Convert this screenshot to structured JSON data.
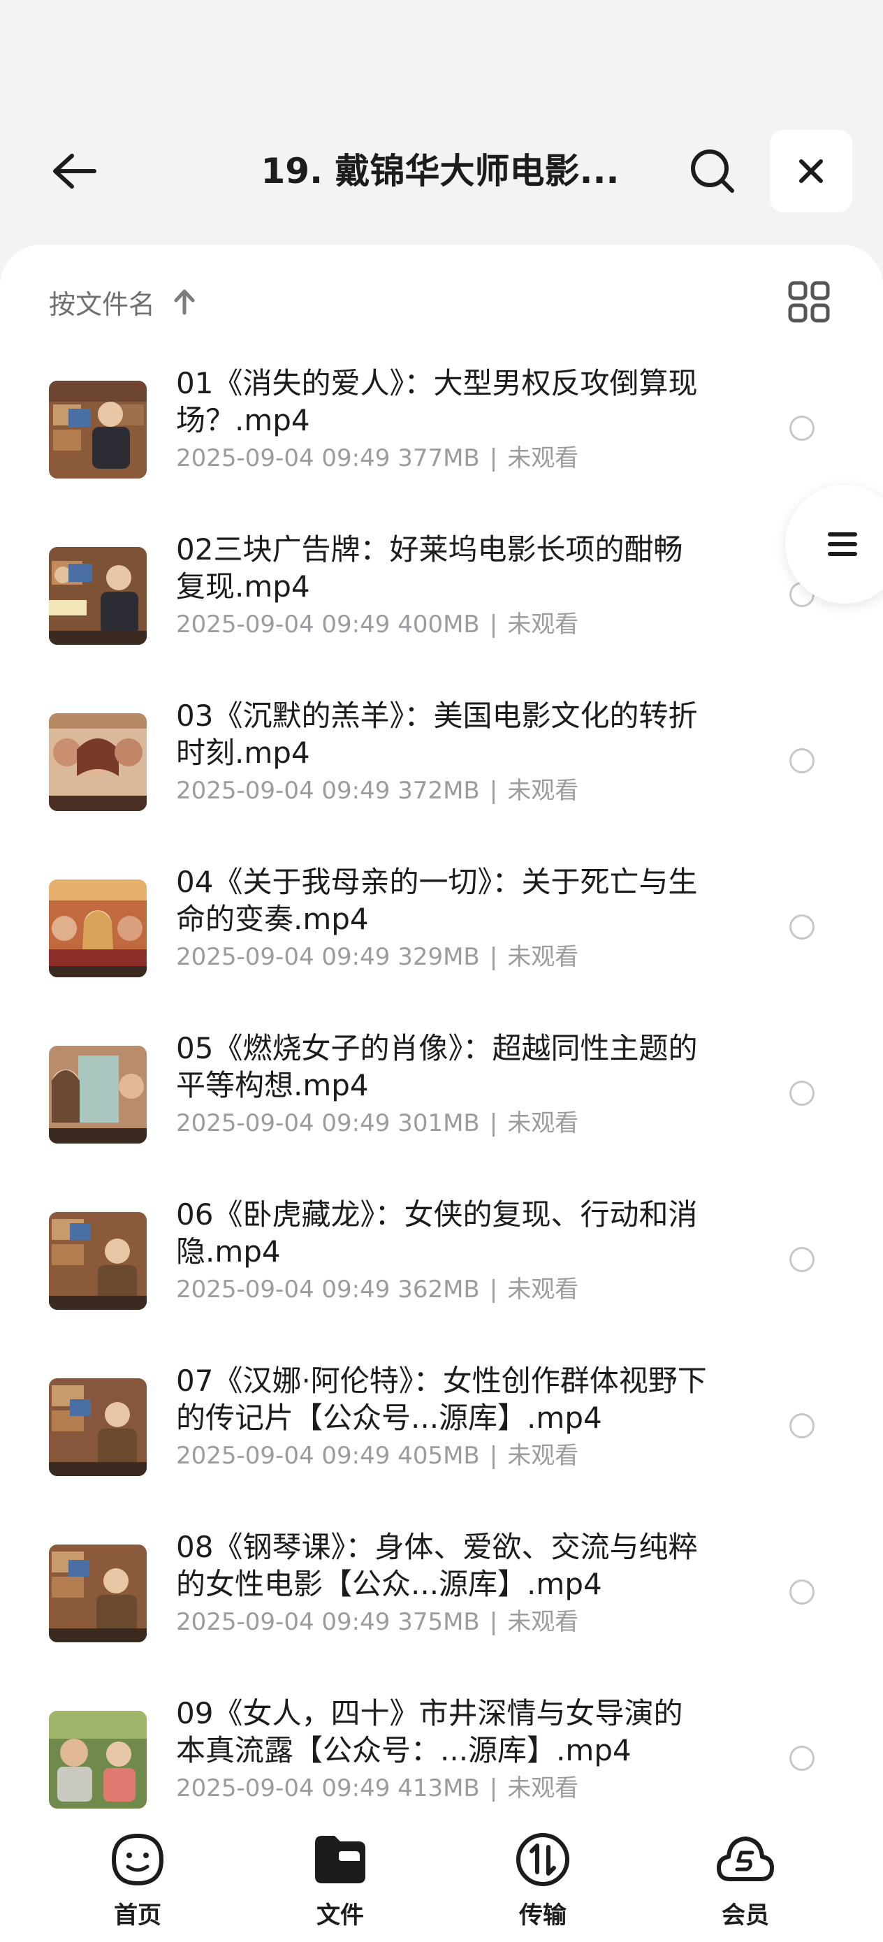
{
  "header": {
    "title": "19. 戴锦华大师电影...",
    "back_icon": "arrow-left-icon",
    "search_icon": "search-icon",
    "close_icon": "close-icon"
  },
  "toolbar": {
    "sort_label": "按文件名",
    "sort_icon": "arrow-up-icon",
    "view_icon": "grid-view-icon"
  },
  "files": [
    {
      "name": "01《消失的爱人》：大型男权反攻倒算现场？.mp4",
      "date": "2025-09-04 09:49",
      "size": "377MB",
      "status": "未观看"
    },
    {
      "name": "02三块广告牌：好莱坞电影长项的酣畅复现.mp4",
      "date": "2025-09-04 09:49",
      "size": "400MB",
      "status": "未观看"
    },
    {
      "name": "03《沉默的羔羊》：美国电影文化的转折时刻.mp4",
      "date": "2025-09-04 09:49",
      "size": "372MB",
      "status": "未观看"
    },
    {
      "name": "04《关于我母亲的一切》：关于死亡与生命的变奏.mp4",
      "date": "2025-09-04 09:49",
      "size": "329MB",
      "status": "未观看"
    },
    {
      "name": "05《燃烧女子的肖像》：超越同性主题的平等构想.mp4",
      "date": "2025-09-04 09:49",
      "size": "301MB",
      "status": "未观看"
    },
    {
      "name": "06《卧虎藏龙》：女侠的复现、行动和消隐.mp4",
      "date": "2025-09-04 09:49",
      "size": "362MB",
      "status": "未观看"
    },
    {
      "name": "07《汉娜·阿伦特》：女性创作群体视野下的传记片【公众号...源库】.mp4",
      "date": "2025-09-04 09:49",
      "size": "405MB",
      "status": "未观看"
    },
    {
      "name": "08《钢琴课》：身体、爱欲、交流与纯粹的女性电影【公众...源库】.mp4",
      "date": "2025-09-04 09:49",
      "size": "375MB",
      "status": "未观看"
    },
    {
      "name": "09《女人，四十》市井深情与女导演的本真流露【公众号：...源库】.mp4",
      "date": "2025-09-04 09:49",
      "size": "413MB",
      "status": "未观看"
    }
  ],
  "float_menu": {
    "icon": "menu-icon"
  },
  "tabs": [
    {
      "label": "首页",
      "icon": "smile-face-icon"
    },
    {
      "label": "文件",
      "icon": "folder-icon"
    },
    {
      "label": "传输",
      "icon": "transfer-icon"
    },
    {
      "label": "会员",
      "icon": "vip-cloud-icon"
    }
  ],
  "colors": {
    "background": "#f3f3f5",
    "panel": "#ffffff",
    "text": "#1c1c1e",
    "meta_text": "#9b9ba0"
  }
}
